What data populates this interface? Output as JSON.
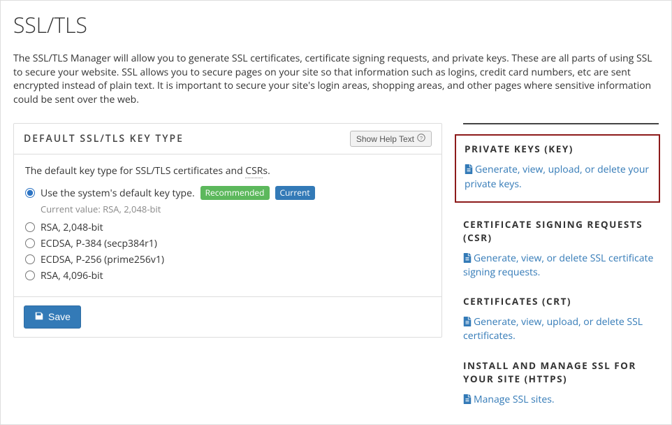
{
  "page": {
    "title": "SSL/TLS",
    "intro": "The SSL/TLS Manager will allow you to generate SSL certificates, certificate signing requests, and private keys. These are all parts of using SSL to secure your website. SSL allows you to secure pages on your site so that information such as logins, credit card numbers, etc are sent encrypted instead of plain text. It is important to secure your site's login areas, shopping areas, and other pages where sensitive information could be sent over the web."
  },
  "panel": {
    "title": "DEFAULT SSL/TLS KEY TYPE",
    "help_label": "Show Help Text",
    "desc_prefix": "The default key type for SSL/TLS certificates and ",
    "desc_abbr": "CSR",
    "desc_suffix": "s.",
    "badges": {
      "recommended": "Recommended",
      "current": "Current"
    },
    "current_value_label": "Current value: RSA, 2,048-bit",
    "options": [
      {
        "label": "Use the system's default key type.",
        "checked": true,
        "is_default": true
      },
      {
        "label": "RSA, 2,048-bit",
        "checked": false,
        "is_default": false
      },
      {
        "label": "ECDSA, P-384 (secp384r1)",
        "checked": false,
        "is_default": false
      },
      {
        "label": "ECDSA, P-256 (prime256v1)",
        "checked": false,
        "is_default": false
      },
      {
        "label": "RSA, 4,096-bit",
        "checked": false,
        "is_default": false
      }
    ],
    "save_label": "Save"
  },
  "sidebar": {
    "sections": [
      {
        "heading": "PRIVATE KEYS (KEY)",
        "link": "Generate, view, upload, or delete your private keys.",
        "highlight": true
      },
      {
        "heading": "CERTIFICATE SIGNING REQUESTS (CSR)",
        "link": "Generate, view, or delete SSL certificate signing requests.",
        "highlight": false
      },
      {
        "heading": "CERTIFICATES (CRT)",
        "link": "Generate, view, upload, or delete SSL certificates.",
        "highlight": false
      },
      {
        "heading": "INSTALL AND MANAGE SSL FOR YOUR SITE (HTTPS)",
        "link": "Manage SSL sites.",
        "highlight": false
      }
    ]
  }
}
